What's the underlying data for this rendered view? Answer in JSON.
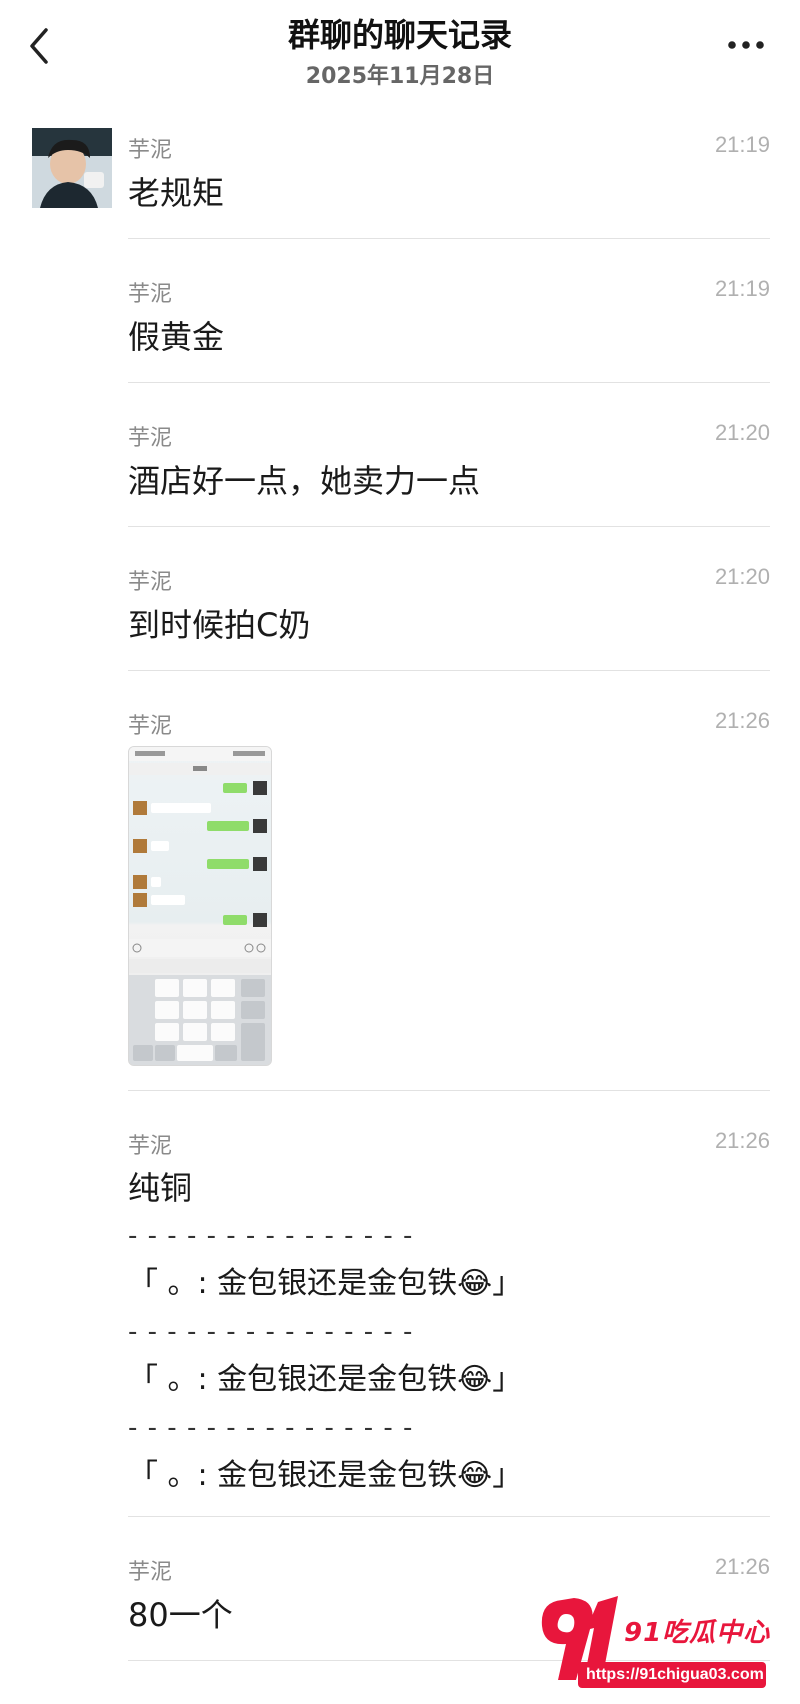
{
  "header": {
    "title": "群聊的聊天记录",
    "date": "2025年11月28日"
  },
  "messages": [
    {
      "sender": "芋泥",
      "time": "21:19",
      "text": "老规矩"
    },
    {
      "sender": "芋泥",
      "time": "21:19",
      "text": "假黄金"
    },
    {
      "sender": "芋泥",
      "time": "21:20",
      "text": "酒店好一点，她卖力一点"
    },
    {
      "sender": "芋泥",
      "time": "21:20",
      "text": "到时候拍C奶"
    },
    {
      "sender": "芋泥",
      "time": "21:26",
      "image": "chat-screenshot-thumbnail"
    },
    {
      "sender": "芋泥",
      "time": "21:26",
      "text": "纯铜",
      "separator": "- - - - - - - - - - - - - - -",
      "quotes": [
        "「 。: 金包银还是金包铁😂」",
        "「 。: 金包银还是金包铁😂」",
        "「 。: 金包银还是金包铁😂」"
      ]
    },
    {
      "sender": "芋泥",
      "time": "21:26",
      "text": "80一个"
    }
  ],
  "watermark": {
    "logo": "91吃瓜中心",
    "url": "https://91chigua03.com"
  },
  "colors": {
    "background": "#ffffff",
    "sender": "#8a8a8a",
    "time": "#b0b0b0",
    "watermark_red": "#e8163c"
  }
}
